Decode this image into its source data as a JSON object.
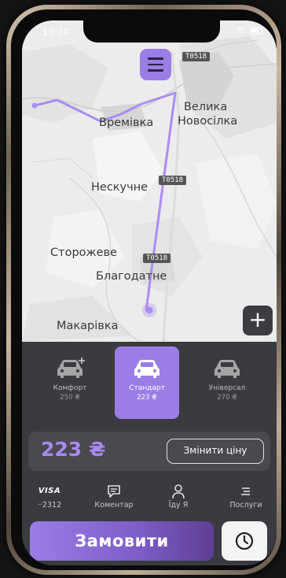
{
  "status_bar": {
    "time": "10:30"
  },
  "map": {
    "places": {
      "velyka": "Велика",
      "novosilka": "Новосілка",
      "vremivka": "Времівка",
      "neskuchne": "Нескучне",
      "storozheve": "Сторожеве",
      "blahodatne": "Благодатне",
      "makarivka": "Макарівка"
    },
    "road_labels": [
      "T0518",
      "T0518",
      "T0518"
    ]
  },
  "tariffs": [
    {
      "name": "Комфорт",
      "price": "250 ₴"
    },
    {
      "name": "Стандарт",
      "price": "223 ₴"
    },
    {
      "name": "Універсал",
      "price": "270 ₴"
    }
  ],
  "price": {
    "value": "223 ₴",
    "change_label": "Змінити ціну"
  },
  "options": {
    "card_brand": "VISA",
    "card_number": "··2312",
    "comment": "Коментар",
    "passenger": "Їду Я",
    "services": "Послуги"
  },
  "order_button": "Замовити",
  "colors": {
    "accent": "#9a7ee6",
    "price_text": "#a889f0",
    "route": "#a98ef0"
  }
}
